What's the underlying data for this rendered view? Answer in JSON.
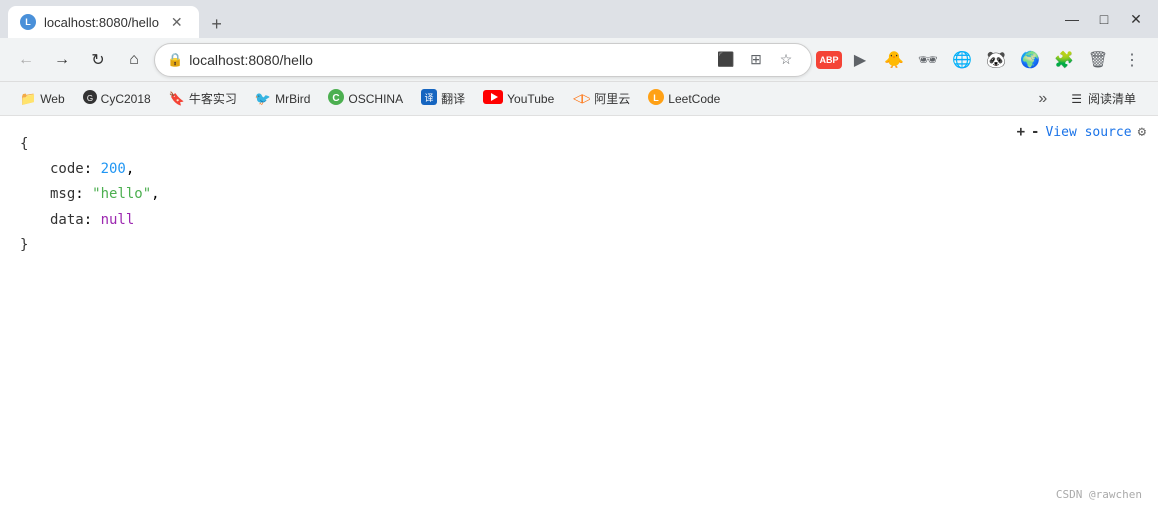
{
  "titlebar": {
    "tab": {
      "title": "localhost:8080/hello",
      "favicon_label": "L"
    },
    "new_tab_label": "+",
    "controls": {
      "minimize": "—",
      "maximize": "□",
      "close": "✕"
    }
  },
  "toolbar": {
    "back_label": "←",
    "forward_label": "→",
    "reload_label": "↻",
    "home_label": "⌂",
    "address": "localhost:8080/hello",
    "lock_icon": "🔒",
    "cast_icon": "⬜",
    "tab_search_icon": "⊞",
    "star_icon": "☆",
    "abp_label": "ABP",
    "profile_label": "▶",
    "ext1": "🐥",
    "ext2": "🕶",
    "ext3": "🌐",
    "ext4": "🐼",
    "ext5": "🌍",
    "ext6": "🧩",
    "ext7": "🗑",
    "more_label": "⋮"
  },
  "bookmarks": {
    "items": [
      {
        "id": "web",
        "icon": "📁",
        "label": "Web",
        "color": "#f5a623"
      },
      {
        "id": "cyc2018",
        "icon": "⚙",
        "label": "CyC2018",
        "color": "#333"
      },
      {
        "id": "niuke",
        "icon": "🔖",
        "label": "牛客实习",
        "color": "#c0392b"
      },
      {
        "id": "mrbird",
        "icon": "🐦",
        "label": "MrBird",
        "color": "#f39c12"
      },
      {
        "id": "oschina",
        "icon": "C",
        "label": "OSCHINA",
        "color": "#4caf50"
      },
      {
        "id": "fanyi",
        "icon": "译",
        "label": "翻译",
        "color": "#1565c0"
      },
      {
        "id": "youtube",
        "icon": "▶",
        "label": "YouTube",
        "color": "#ff0000"
      },
      {
        "id": "aliyun",
        "icon": "◁▷",
        "label": "阿里云",
        "color": "#ff6a00"
      },
      {
        "id": "leetcode",
        "icon": "L",
        "label": "LeetCode",
        "color": "#ffa116"
      }
    ],
    "more_label": "»",
    "reading_mode_icon": "☰",
    "reading_mode_label": "阅读清单"
  },
  "content": {
    "json": {
      "open_brace": "{",
      "code_key": "code",
      "code_value": "200",
      "msg_key": "msg",
      "msg_value": "\"hello\"",
      "data_key": "data",
      "data_value": "null",
      "close_brace": "}"
    },
    "view_source": {
      "plus": "+",
      "minus": "-",
      "link": "View source",
      "gear": "⚙"
    },
    "watermark": "CSDN @rawchen"
  }
}
